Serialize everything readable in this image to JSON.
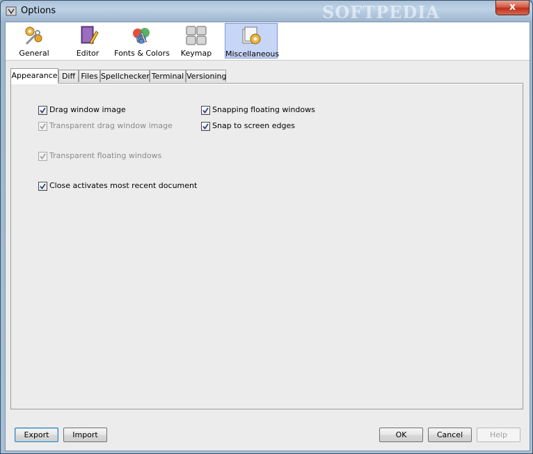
{
  "window": {
    "title": "Options",
    "watermark": "SOFTPEDIA",
    "close_label": "x"
  },
  "toolbar": {
    "items": [
      {
        "label": "General",
        "icon": "gears-wrench-icon"
      },
      {
        "label": "Editor",
        "icon": "book-pencil-icon"
      },
      {
        "label": "Fonts & Colors",
        "icon": "font-palette-icon"
      },
      {
        "label": "Keymap",
        "icon": "keyboard-icon"
      },
      {
        "label": "Miscellaneous",
        "icon": "misc-gear-icon",
        "selected": true
      }
    ]
  },
  "tabs": [
    "Appearance",
    "Diff",
    "Files",
    "Spellchecker",
    "Terminal",
    "Versioning"
  ],
  "active_tab": "Appearance",
  "options": [
    {
      "label": "Drag window image",
      "checked": true,
      "enabled": true
    },
    {
      "label": "Transparent drag window image",
      "checked": true,
      "enabled": false
    },
    {
      "label": "Transparent floating windows",
      "checked": true,
      "enabled": false
    },
    {
      "label": "Close activates most recent document",
      "checked": true,
      "enabled": true
    },
    {
      "label": "Snapping floating windows",
      "checked": true,
      "enabled": true
    },
    {
      "label": "Snap to screen edges",
      "checked": true,
      "enabled": true
    }
  ],
  "buttons": {
    "export": "Export",
    "import": "Import",
    "ok": "OK",
    "cancel": "Cancel",
    "help": "Help"
  },
  "colors": {
    "selected_tool_bg": "#c7d6f7",
    "title_bar": "#a9c1d9",
    "close_button": "#c0301b"
  }
}
